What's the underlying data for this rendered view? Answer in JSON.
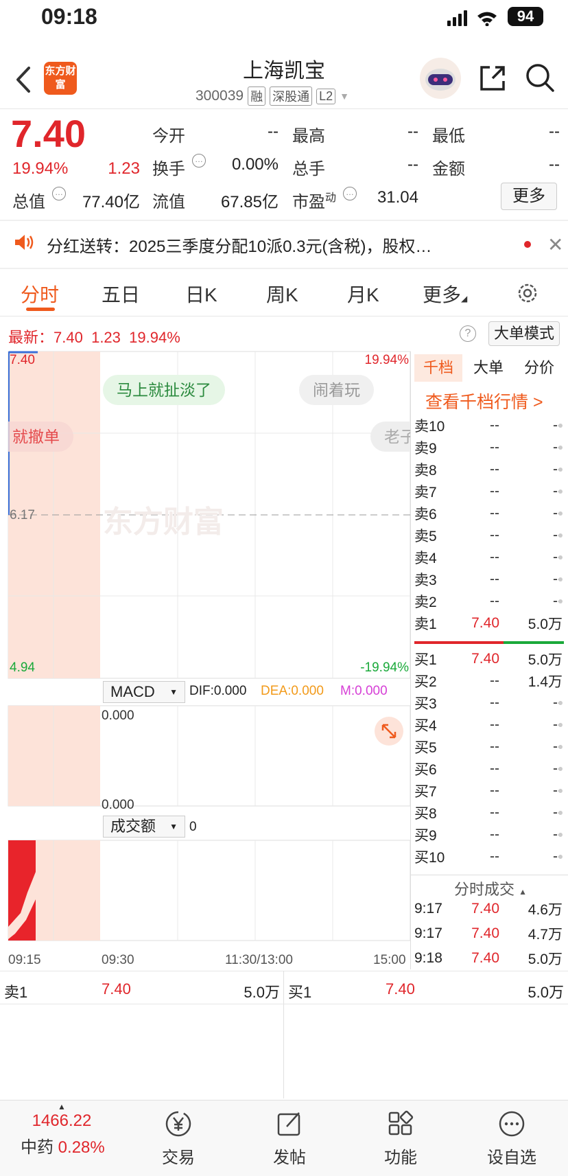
{
  "status": {
    "time": "09:18",
    "battery": "94"
  },
  "header": {
    "logo": "东方财富",
    "title": "上海凯宝",
    "code": "300039",
    "tags": [
      "融",
      "深股通",
      "L2"
    ]
  },
  "quote": {
    "price": "7.40",
    "change_pct": "19.94%",
    "change": "1.23",
    "fields": [
      {
        "label": "今开",
        "value": "--"
      },
      {
        "label": "最高",
        "value": "--"
      },
      {
        "label": "最低",
        "value": "--"
      },
      {
        "label": "换手",
        "value": "0.00%"
      },
      {
        "label": "总手",
        "value": "--"
      },
      {
        "label": "金额",
        "value": "--"
      },
      {
        "label": "总值",
        "value": "77.40亿"
      },
      {
        "label": "流值",
        "value": "67.85亿"
      },
      {
        "label": "市盈",
        "sup": "动",
        "value": "31.04"
      }
    ],
    "more": "更多"
  },
  "notice": {
    "text": "分红送转：2025三季度分配10派0.3元(含税)，股权…"
  },
  "tabs": [
    "分时",
    "五日",
    "日K",
    "周K",
    "月K",
    "更多"
  ],
  "chart": {
    "latest_label": "最新：",
    "latest_price": "7.40",
    "latest_change": "1.23",
    "latest_pct": "19.94%",
    "big_mode": "大单模式",
    "y_top": "7.40",
    "y_mid": "6.17",
    "y_bottom": "4.94",
    "pct_top": "19.94%",
    "pct_bottom": "-19.94%",
    "watermark": "东方财富",
    "danmaku": [
      "马上就扯淡了",
      "闹着玩",
      "就撤单",
      "老子"
    ],
    "macd_label": "MACD",
    "dif": "DIF:0.000",
    "dea": "DEA:0.000",
    "m": "M:0.000",
    "macd_top": "0.000",
    "macd_bottom": "0.000",
    "vol_label": "成交额",
    "vol_value": "0",
    "x_ticks": [
      "09:15",
      "09:30",
      "11:30/13:00",
      "15:00"
    ]
  },
  "orderbook": {
    "tabs": [
      "千档",
      "大单",
      "分价"
    ],
    "view_link": "查看千档行情 >",
    "asks": [
      {
        "label": "卖10",
        "price": "--",
        "vol": "--"
      },
      {
        "label": "卖9",
        "price": "--",
        "vol": "--"
      },
      {
        "label": "卖8",
        "price": "--",
        "vol": "--"
      },
      {
        "label": "卖7",
        "price": "--",
        "vol": "--"
      },
      {
        "label": "卖6",
        "price": "--",
        "vol": "--"
      },
      {
        "label": "卖5",
        "price": "--",
        "vol": "--"
      },
      {
        "label": "卖4",
        "price": "--",
        "vol": "--"
      },
      {
        "label": "卖3",
        "price": "--",
        "vol": "--"
      },
      {
        "label": "卖2",
        "price": "--",
        "vol": "--"
      },
      {
        "label": "卖1",
        "price": "7.40",
        "vol": "5.0万"
      }
    ],
    "bids": [
      {
        "label": "买1",
        "price": "7.40",
        "vol": "5.0万"
      },
      {
        "label": "买2",
        "price": "--",
        "vol": "1.4万"
      },
      {
        "label": "买3",
        "price": "--",
        "vol": "--"
      },
      {
        "label": "买4",
        "price": "--",
        "vol": "--"
      },
      {
        "label": "买5",
        "price": "--",
        "vol": "--"
      },
      {
        "label": "买6",
        "price": "--",
        "vol": "--"
      },
      {
        "label": "买7",
        "price": "--",
        "vol": "--"
      },
      {
        "label": "买8",
        "price": "--",
        "vol": "--"
      },
      {
        "label": "买9",
        "price": "--",
        "vol": "--"
      },
      {
        "label": "买10",
        "price": "--",
        "vol": "--"
      }
    ],
    "trades_title": "分时成交",
    "trades": [
      {
        "time": "9:17",
        "price": "7.40",
        "vol": "4.6万"
      },
      {
        "time": "9:17",
        "price": "7.40",
        "vol": "4.7万"
      },
      {
        "time": "9:18",
        "price": "7.40",
        "vol": "5.0万"
      }
    ]
  },
  "summary": {
    "sell_label": "卖1",
    "sell_price": "7.40",
    "sell_vol": "5.0万",
    "buy_label": "买1",
    "buy_price": "7.40",
    "buy_vol": "5.0万"
  },
  "bottom": {
    "index_value": "1466.22",
    "index_name": "中药",
    "index_pct": "0.28%",
    "items": [
      "交易",
      "发帖",
      "功能",
      "设自选"
    ]
  },
  "colors": {
    "accent": "#ef5a1d",
    "up": "#e0262b",
    "down": "#1aa93a"
  }
}
